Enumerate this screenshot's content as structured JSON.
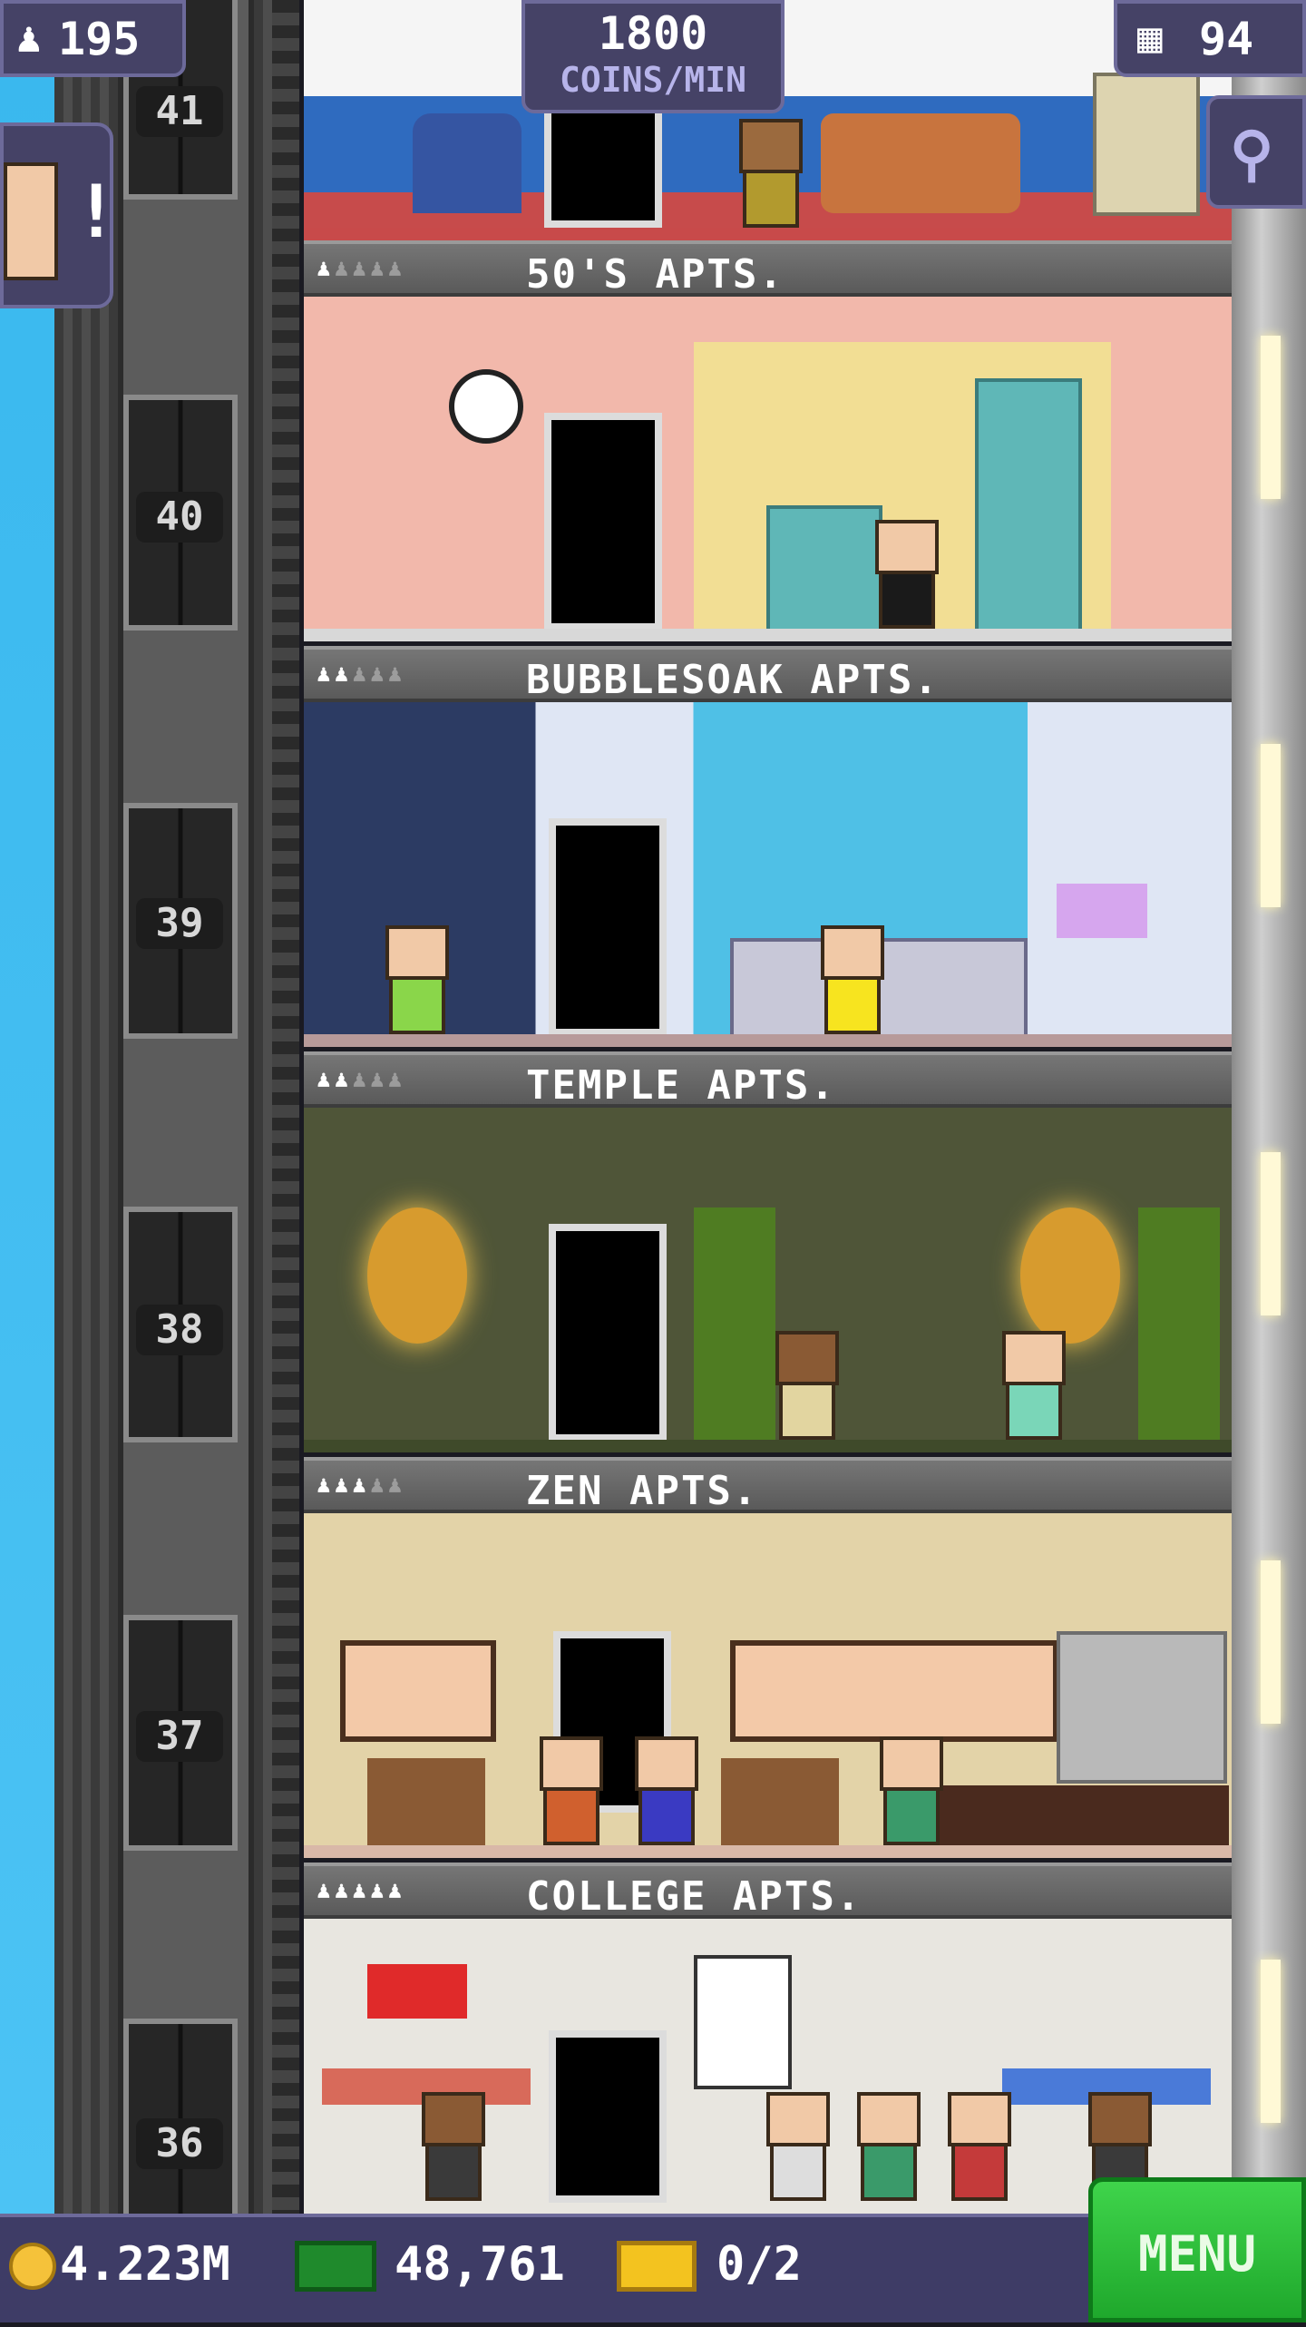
{
  "hud": {
    "population": "195",
    "coins_per_min_value": "1800",
    "coins_per_min_label": "COINS/MIN",
    "floors": "94"
  },
  "elevator": {
    "floor_numbers": [
      "41",
      "40",
      "39",
      "38",
      "37",
      "36"
    ]
  },
  "floors": [
    {
      "name": "50'S APTS.",
      "stars_filled": 1,
      "stars_total": 5
    },
    {
      "name": "BUBBLESOAK APTS.",
      "stars_filled": 2,
      "stars_total": 5
    },
    {
      "name": "TEMPLE APTS.",
      "stars_filled": 2,
      "stars_total": 5
    },
    {
      "name": "ZEN APTS.",
      "stars_filled": 3,
      "stars_total": 5
    },
    {
      "name": "COLLEGE APTS.",
      "stars_filled": 5,
      "stars_total": 5
    }
  ],
  "bottom_bar": {
    "coins": "4.223M",
    "bux": "48,761",
    "tickets": "0/2",
    "menu_label": "MENU"
  },
  "colors": {
    "hud_bg": "#454266",
    "menu_green": "#2fc03c",
    "sky": "#39b8ee"
  }
}
